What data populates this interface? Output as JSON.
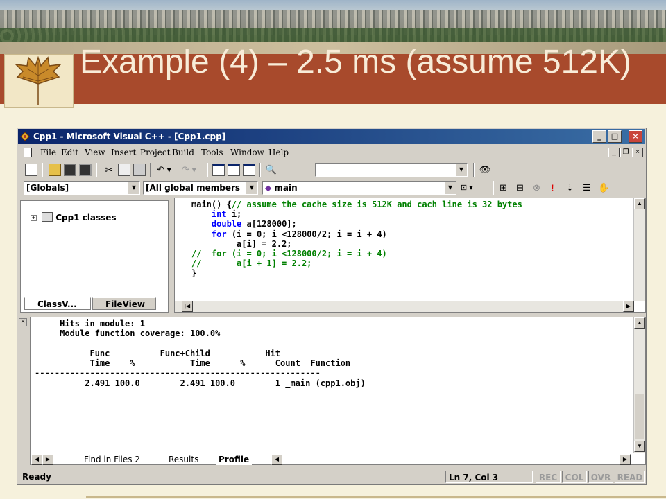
{
  "slide": {
    "title": "Example (4) – 2.5 ms (assume 512K)"
  },
  "window": {
    "title": "Cpp1 - Microsoft Visual C++ - [Cpp1.cpp]",
    "controls": {
      "minimize": "_",
      "maximize": "□",
      "close": "×"
    },
    "mdi_controls": {
      "minimize": "_",
      "restore": "❐",
      "close": "×"
    }
  },
  "menu": {
    "items": [
      "File",
      "Edit",
      "View",
      "Insert",
      "Project",
      "Build",
      "Tools",
      "Window",
      "Help"
    ]
  },
  "wizardbar": {
    "scope": "[Globals]",
    "filter": "[All global members",
    "member": "main"
  },
  "workspace": {
    "tree_root": "Cpp1 classes",
    "expand_glyph": "+",
    "tabs": [
      "ClassV...",
      "FileView"
    ]
  },
  "editor": {
    "lines": [
      {
        "pre": "main() {",
        "kw": "",
        "text": "",
        "comment": "// assume the cache size is 512K and cach line is 32 bytes"
      },
      {
        "pre": "    ",
        "kw": "int",
        "text": " i;",
        "comment": ""
      },
      {
        "pre": "    ",
        "kw": "double",
        "text": " a[128000];",
        "comment": ""
      },
      {
        "pre": "    ",
        "kw": "for",
        "text": " (i = 0; i <128000/2; i = i + 4)",
        "comment": ""
      },
      {
        "pre": "         ",
        "kw": "",
        "text": "a[i] = 2.2;",
        "comment": ""
      },
      {
        "pre": "",
        "kw": "",
        "text": "",
        "comment": "//  for (i = 0; i <128000/2; i = i + 4)"
      },
      {
        "pre": "",
        "kw": "",
        "text": "",
        "comment": "//       a[i + 1] = 2.2;"
      },
      {
        "pre": "}",
        "kw": "",
        "text": "",
        "comment": ""
      }
    ]
  },
  "output": {
    "lines": [
      "     Hits in module: 1",
      "     Module function coverage: 100.0%",
      "",
      "           Func          Func+Child           Hit",
      "           Time    %           Time      %      Count  Function",
      "---------------------------------------------------------",
      "          2.491 100.0        2.491 100.0        1 _main (cpp1.obj)"
    ],
    "tabs": [
      "Find in Files 2",
      "Results",
      "Profile"
    ]
  },
  "status": {
    "text": "Ready",
    "position": "Ln 7, Col 3",
    "indicators": [
      "REC",
      "COL",
      "OVR",
      "READ"
    ]
  },
  "colors": {
    "title_band": "#a84a2c",
    "slide_bg": "#f6f1dc",
    "keyword": "#0000ff",
    "comment": "#008000"
  }
}
